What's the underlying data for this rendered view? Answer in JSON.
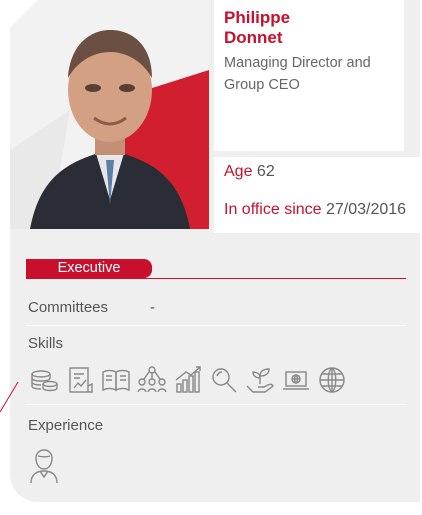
{
  "profile": {
    "name": "Philippe Donnet",
    "name_line1": "Philippe",
    "name_line2": "Donnet",
    "role": "Managing Director and Group CEO",
    "age_label": "Age",
    "age_value": "62",
    "in_office_label": "In office since",
    "in_office_value": "27/03/2016",
    "badge": "Executive",
    "committees_label": "Committees",
    "committees_value": "-",
    "skills_label": "Skills",
    "experience_label": "Experience",
    "skills_icons": [
      "coins-icon",
      "report-chart-icon",
      "book-icon",
      "people-network-icon",
      "growth-bars-icon",
      "magnifier-icon",
      "plant-hand-icon",
      "laptop-globe-icon",
      "globe-icon"
    ],
    "experience_icons": [
      "person-icon"
    ]
  },
  "colors": {
    "accent": "#c8102e",
    "card_bg": "#efefef",
    "text": "#555555"
  }
}
